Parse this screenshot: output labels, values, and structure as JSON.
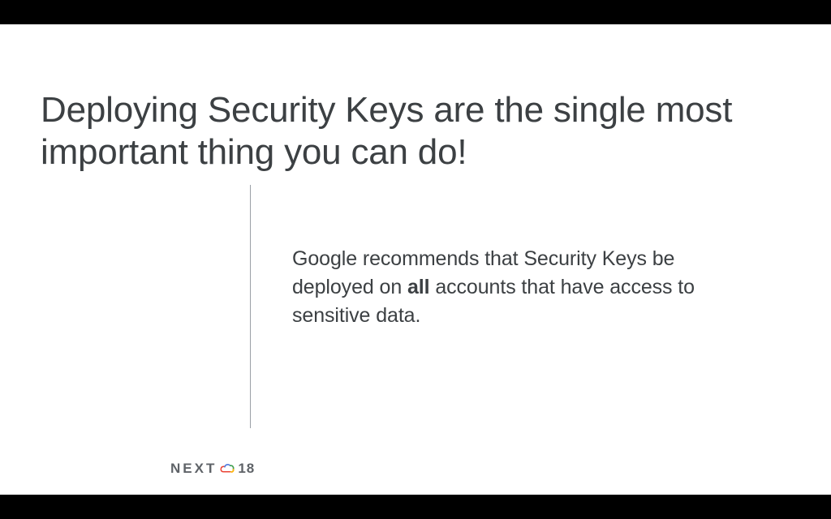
{
  "title": "Deploying Security Keys are the single most important thing you can do!",
  "body_pre": "Google recommends that Security Keys be deployed on ",
  "body_bold": "all",
  "body_post": " accounts that have access to sensitive data.",
  "footer": {
    "brand": "NEXT",
    "year_suffix": "18"
  }
}
